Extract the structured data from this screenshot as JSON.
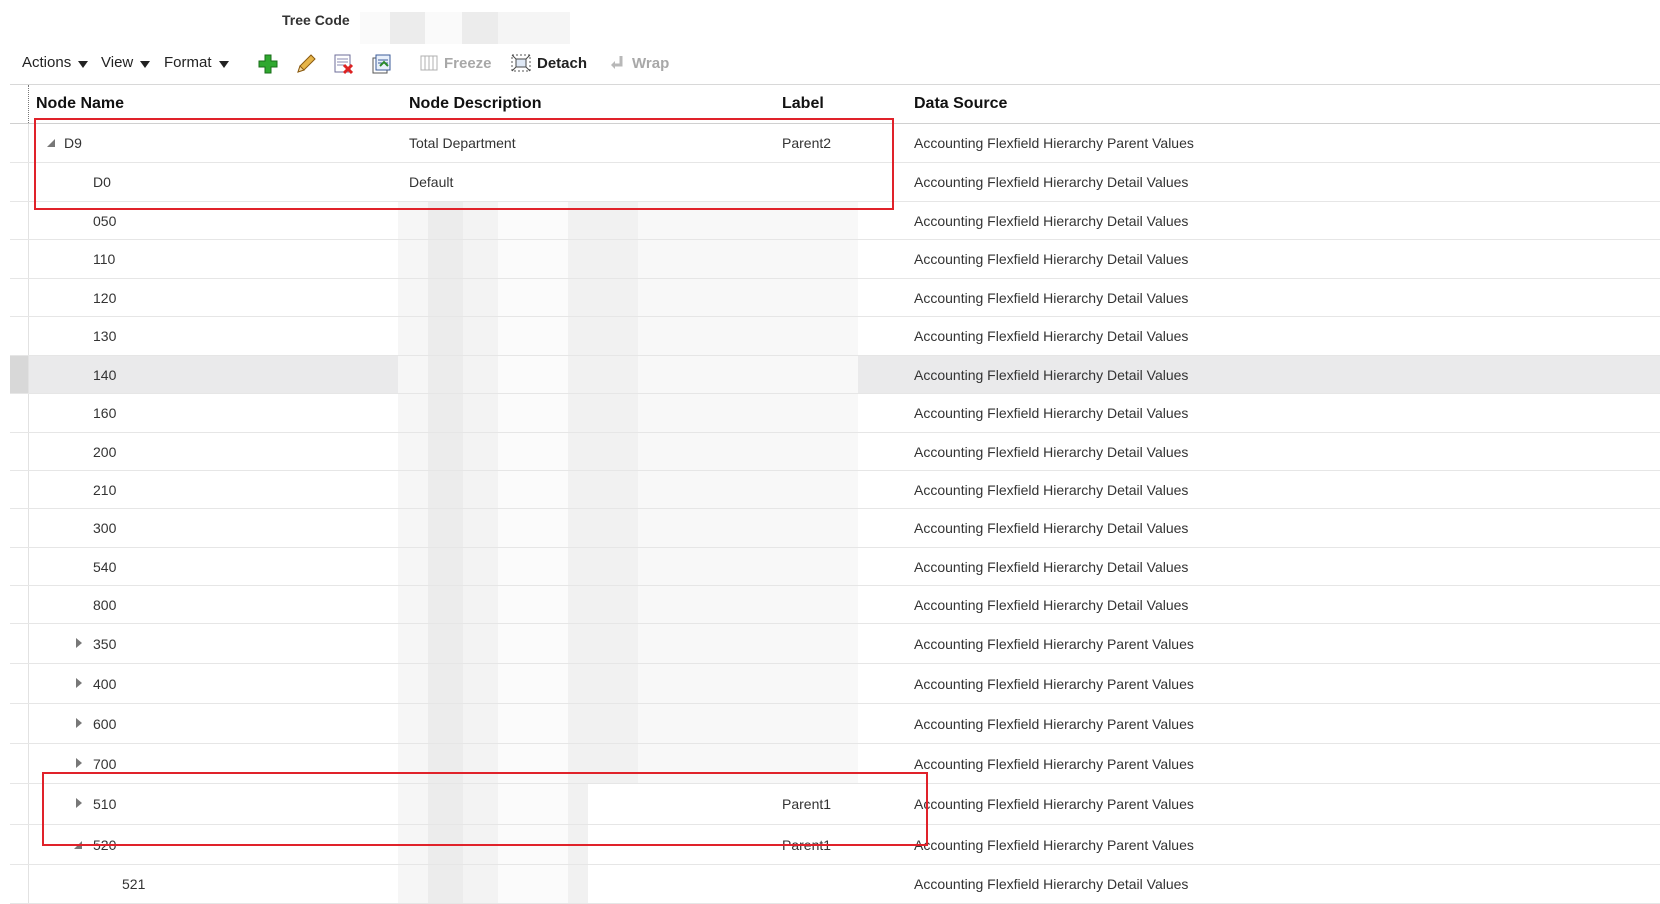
{
  "tree_code": {
    "label": "Tree Code"
  },
  "toolbar": {
    "menus": [
      {
        "label": "Actions"
      },
      {
        "label": "View"
      },
      {
        "label": "Format"
      }
    ],
    "freeze_label": "Freeze",
    "detach_label": "Detach",
    "wrap_label": "Wrap",
    "icons": [
      "add-icon",
      "edit-pencil-icon",
      "delete-icon",
      "export-icon",
      "freeze-icon",
      "detach-icon",
      "wrap-icon"
    ]
  },
  "table": {
    "columns": [
      "Node Name",
      "Node Description",
      "Label",
      "Data Source"
    ],
    "rows": [
      {
        "name": "D9",
        "description": "Total Department",
        "label": "Parent2",
        "source": "Accounting Flexfield Hierarchy Parent Values"
      },
      {
        "name": "D0",
        "description": "Default",
        "label": "",
        "source": "Accounting Flexfield Hierarchy Detail Values"
      },
      {
        "name": "050",
        "description": "",
        "label": "",
        "source": "Accounting Flexfield Hierarchy Detail Values"
      },
      {
        "name": "110",
        "description": "",
        "label": "",
        "source": "Accounting Flexfield Hierarchy Detail Values"
      },
      {
        "name": "120",
        "description": "",
        "label": "",
        "source": "Accounting Flexfield Hierarchy Detail Values"
      },
      {
        "name": "130",
        "description": "",
        "label": "",
        "source": "Accounting Flexfield Hierarchy Detail Values"
      },
      {
        "name": "140",
        "description": "",
        "label": "",
        "source": "Accounting Flexfield Hierarchy Detail Values"
      },
      {
        "name": "160",
        "description": "",
        "label": "",
        "source": "Accounting Flexfield Hierarchy Detail Values"
      },
      {
        "name": "200",
        "description": "",
        "label": "",
        "source": "Accounting Flexfield Hierarchy Detail Values"
      },
      {
        "name": "210",
        "description": "",
        "label": "",
        "source": "Accounting Flexfield Hierarchy Detail Values"
      },
      {
        "name": "300",
        "description": "",
        "label": "",
        "source": "Accounting Flexfield Hierarchy Detail Values"
      },
      {
        "name": "540",
        "description": "",
        "label": "",
        "source": "Accounting Flexfield Hierarchy Detail Values"
      },
      {
        "name": "800",
        "description": "",
        "label": "",
        "source": "Accounting Flexfield Hierarchy Detail Values"
      },
      {
        "name": "350",
        "description": "",
        "label": "",
        "source": "Accounting Flexfield Hierarchy Parent Values"
      },
      {
        "name": "400",
        "description": "",
        "label": "",
        "source": "Accounting Flexfield Hierarchy Parent Values"
      },
      {
        "name": "600",
        "description": "",
        "label": "",
        "source": "Accounting Flexfield Hierarchy Parent Values"
      },
      {
        "name": "700",
        "description": "",
        "label": "",
        "source": "Accounting Flexfield Hierarchy Parent Values"
      },
      {
        "name": "510",
        "description": "",
        "label": "Parent1",
        "source": "Accounting Flexfield Hierarchy Parent Values"
      },
      {
        "name": "520",
        "description": "",
        "label": "Parent1",
        "source": "Accounting Flexfield Hierarchy Parent Values"
      },
      {
        "name": "521",
        "description": "",
        "label": "",
        "source": "Accounting Flexfield Hierarchy Detail Values"
      }
    ]
  },
  "colors": {
    "highlight": "#e0222a",
    "selected_row": "#eaeaeb"
  }
}
